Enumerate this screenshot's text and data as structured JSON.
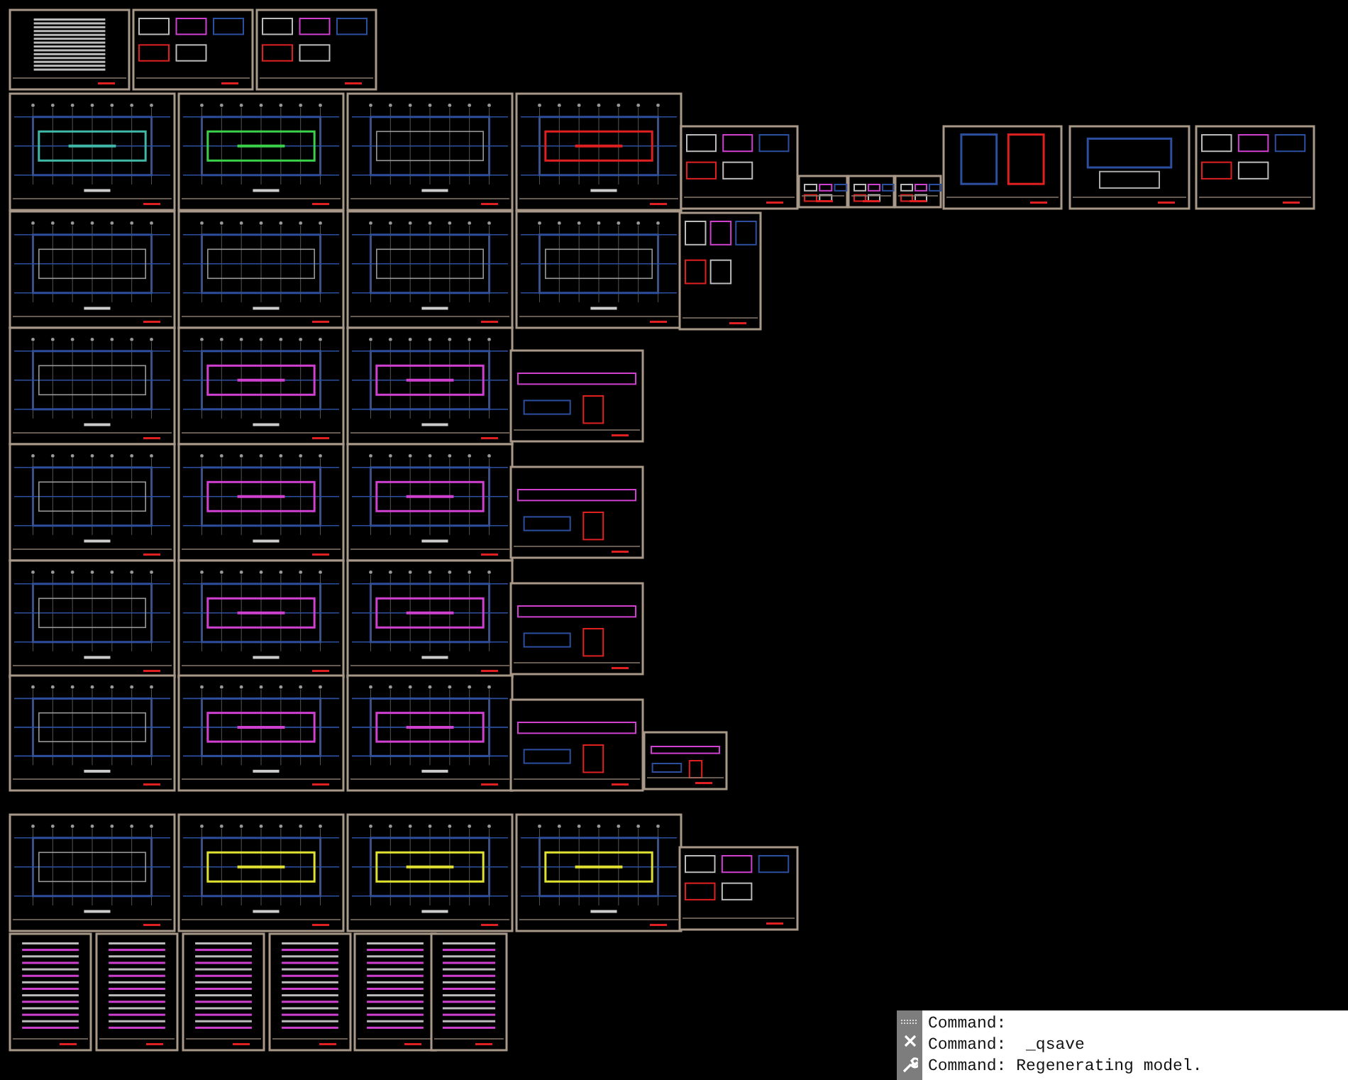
{
  "command_line": {
    "lines": [
      "Command:",
      "Command:  _qsave",
      "Command: Regenerating model."
    ]
  }
}
